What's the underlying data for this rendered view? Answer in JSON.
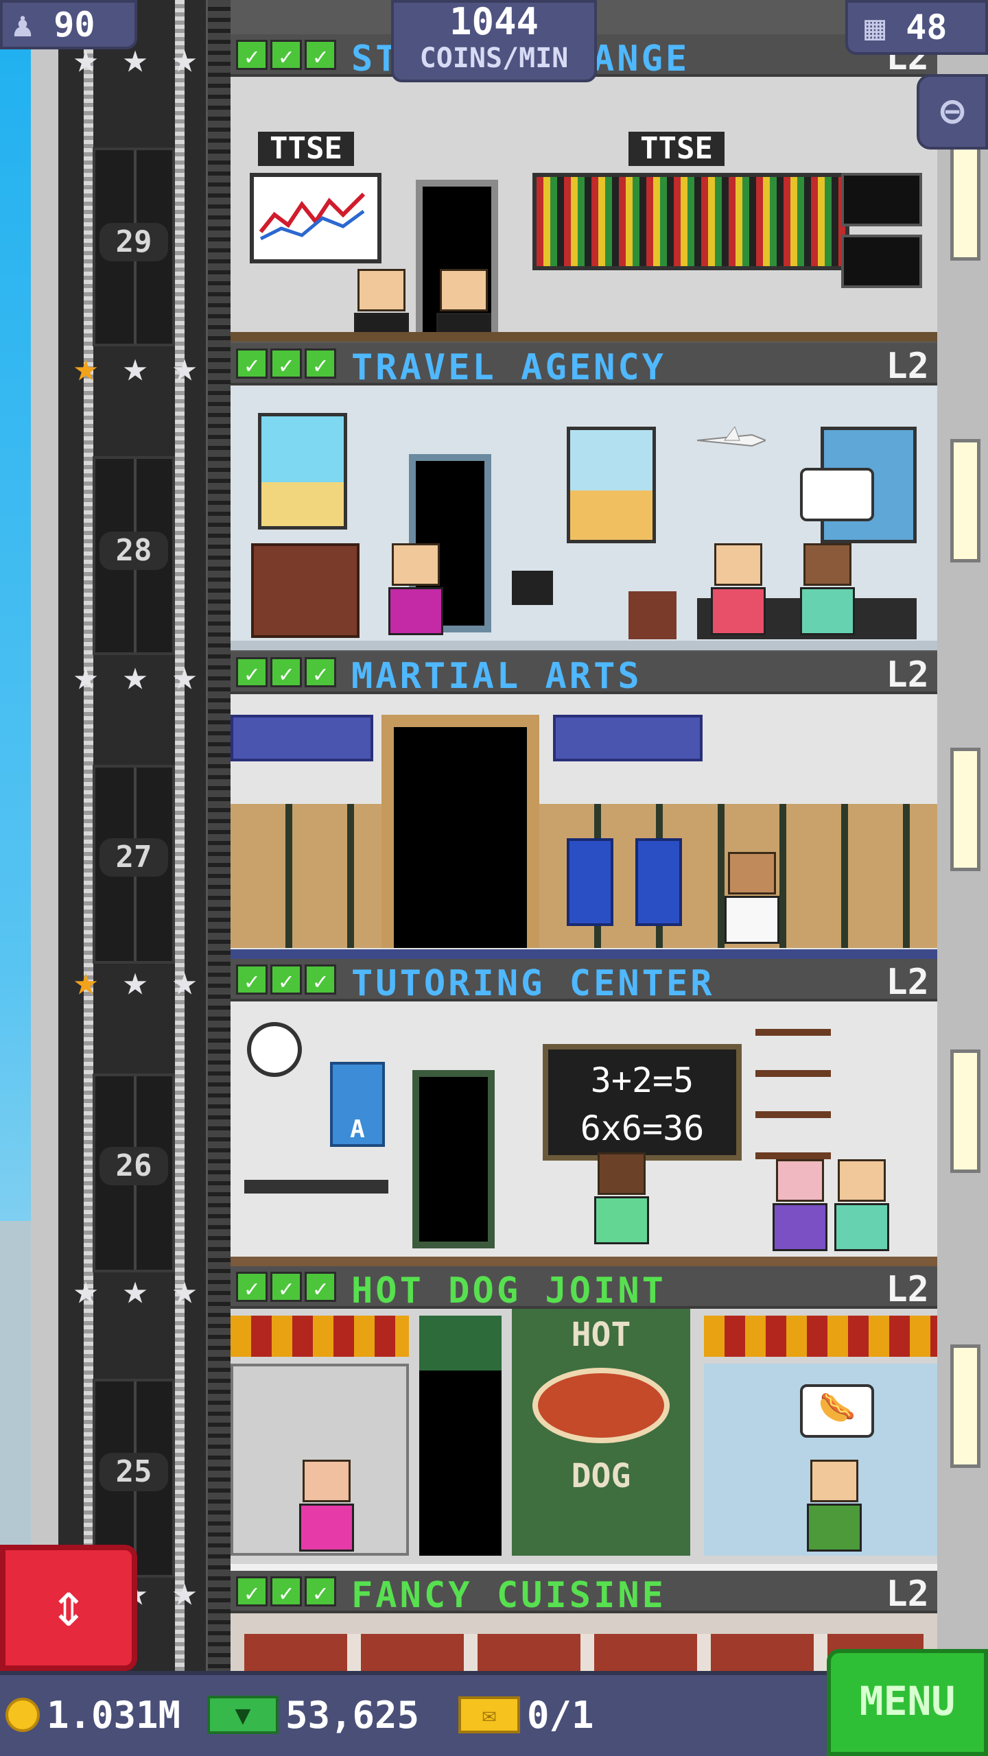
{
  "hud": {
    "population": "90",
    "coins_per_min_value": "1044",
    "coins_per_min_label": "COINS/MIN",
    "floors_count": "48",
    "coins": "1.031M",
    "bux": "53,625",
    "tickets": "0/1",
    "menu_label": "MENU"
  },
  "icons": {
    "population": "person-icon",
    "floors": "building-grid-icon",
    "zoom": "magnifier-minus-icon",
    "elevator": "up-down-arrows-icon",
    "coin": "coin-icon",
    "bux": "bux-cash-icon",
    "ticket": "golden-ticket-icon"
  },
  "colors": {
    "service_title": "#4fb8ff",
    "food_title": "#57e04f",
    "menu_button": "#2fbf36",
    "elevator_button": "#e6293d",
    "hud_panel": "#4e5380"
  },
  "floors": [
    {
      "number": "29",
      "name": "ST",
      "name_tail": "ANGE",
      "level": "L2",
      "stars": 3,
      "gold_stars": 0,
      "signs": [
        "TTSE",
        "TTSE"
      ]
    },
    {
      "number": "28",
      "name": "TRAVEL AGENCY",
      "level": "L2",
      "stars": 3,
      "gold_stars": 1
    },
    {
      "number": "27",
      "name": "MARTIAL ARTS",
      "level": "L2",
      "stars": 3,
      "gold_stars": 0
    },
    {
      "number": "26",
      "name": "TUTORING CENTER",
      "level": "L2",
      "stars": 3,
      "gold_stars": 1,
      "board": [
        "3+2=5",
        "6x6=36"
      ],
      "poster_letter": "A"
    },
    {
      "number": "25",
      "name": "HOT DOG JOINT",
      "level": "L2",
      "stars": 3,
      "gold_stars": 0,
      "sign_top": "HOT",
      "sign_bottom": "DOG"
    },
    {
      "name": "FANCY CUISINE",
      "level": "L2",
      "stars": 3,
      "gold_stars": 0
    }
  ]
}
